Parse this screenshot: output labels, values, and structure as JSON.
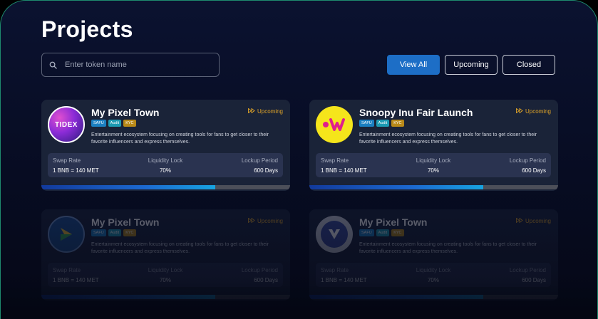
{
  "page": {
    "title": "Projects"
  },
  "search": {
    "placeholder": "Enter token name"
  },
  "filters": [
    {
      "label": "View All",
      "active": true
    },
    {
      "label": "Upcoming",
      "active": false
    },
    {
      "label": "Closed",
      "active": false
    }
  ],
  "colors": {
    "accent": "#1d6ec6",
    "status": "#e0a428",
    "card_bg": "#1a2338"
  },
  "cards": [
    {
      "title": "My Pixel Town",
      "status": "Upcoming",
      "logo_icon": "tidex-logo",
      "logo_text": "TIDEX",
      "badges": [
        "SAFU",
        "Audit",
        "KYC"
      ],
      "description": "Entertainment ecosystem focusing on creating tools for fans to get closer to their favorite influencers and express themselves.",
      "stats": {
        "swap_rate_label": "Swap Rate",
        "swap_rate_value": "1 BNB = 140 MET",
        "liquidity_label": "Liquidity Lock",
        "liquidity_value": "70%",
        "lockup_label": "Lockup Period",
        "lockup_value": "600 Days"
      },
      "progress": 0.7
    },
    {
      "title": "Snoopy Inu Fair Launch",
      "status": "Upcoming",
      "logo_icon": "w-logo",
      "badges": [
        "SAFU",
        "Audit",
        "KYC"
      ],
      "description": "Entertainment ecosystem focusing on creating tools for fans to get closer to their favorite influencers and express themselves.",
      "stats": {
        "swap_rate_label": "Swap Rate",
        "swap_rate_value": "1 BNB = 140 MET",
        "liquidity_label": "Liquidity Lock",
        "liquidity_value": "70%",
        "lockup_label": "Lockup Period",
        "lockup_value": "600 Days"
      },
      "progress": 0.7
    },
    {
      "title": "My Pixel Town",
      "status": "Upcoming",
      "logo_icon": "arrow-logo",
      "badges": [
        "SAFU",
        "Audit",
        "KYC"
      ],
      "description": "Entertainment ecosystem focusing on creating tools for fans to get closer to their favorite influencers and express themselves.",
      "stats": {
        "swap_rate_label": "Swap Rate",
        "swap_rate_value": "1 BNB = 140 MET",
        "liquidity_label": "Liquidity Lock",
        "liquidity_value": "70%",
        "lockup_label": "Lockup Period",
        "lockup_value": "600 Days"
      },
      "progress": 0.7
    },
    {
      "title": "My Pixel Town",
      "status": "Upcoming",
      "logo_icon": "v-logo",
      "badges": [
        "SAFU",
        "Audit",
        "KYC"
      ],
      "description": "Entertainment ecosystem focusing on creating tools for fans to get closer to their favorite influencers and express themselves.",
      "stats": {
        "swap_rate_label": "Swap Rate",
        "swap_rate_value": "1 BNB = 140 MET",
        "liquidity_label": "Liquidity Lock",
        "liquidity_value": "70%",
        "lockup_label": "Lockup Period",
        "lockup_value": "600 Days"
      },
      "progress": 0.7
    }
  ]
}
